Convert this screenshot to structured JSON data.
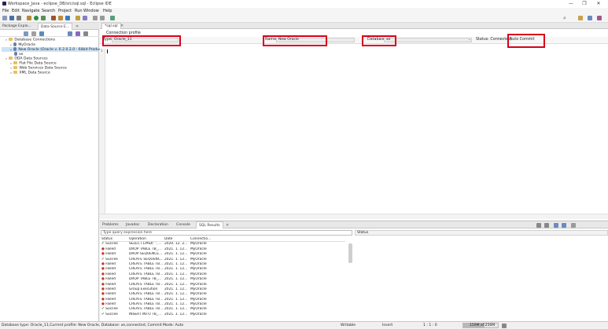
{
  "window": {
    "title": "Workspace_Java - eclipse_DB/src/sql.sql - Eclipse IDE",
    "minimize": "—",
    "maximize": "❐",
    "close": "✕"
  },
  "menu": [
    "File",
    "Edit",
    "Navigate",
    "Search",
    "Project",
    "Run",
    "Window",
    "Help"
  ],
  "left_panel": {
    "tabs": [
      {
        "label": "Package Explo..."
      },
      {
        "label": "Data Source E..."
      }
    ],
    "tree": [
      {
        "label": "Database Connections",
        "indent": 0,
        "icon": "folder-icon"
      },
      {
        "label": "MyOracle",
        "indent": 1,
        "icon": "database-icon"
      },
      {
        "label": "New Oracle (Oracle v. 0.2.0.2.0 - 64bit Product",
        "indent": 1,
        "icon": "database-icon",
        "selected": true
      },
      {
        "label": "xe",
        "indent": 2,
        "icon": "database-icon"
      },
      {
        "label": "ODA Data Sources",
        "indent": 0,
        "icon": "folder-icon"
      },
      {
        "label": "Flat File Data Source",
        "indent": 1,
        "icon": "folder-icon"
      },
      {
        "label": "Web Services Data Source",
        "indent": 1,
        "icon": "folder-icon"
      },
      {
        "label": "XML Data Source",
        "indent": 1,
        "icon": "folder-icon"
      }
    ]
  },
  "editor": {
    "tab_label": "*sql.sql",
    "section_label": "Connection profile",
    "type_label": "Type:",
    "type_value": "Oracle_11",
    "name_label": "Name:",
    "name_value": "New Oracle",
    "database_label": "Database:",
    "database_value": "xe",
    "status_label": "Status: Connected,",
    "autocommit_value": "Auto Commit",
    "line_number": "1"
  },
  "bottom": {
    "tabs": [
      {
        "label": "Problems"
      },
      {
        "label": "Javadoc"
      },
      {
        "label": "Declaration"
      },
      {
        "label": "Console"
      },
      {
        "label": "SQL Results",
        "active": true
      }
    ],
    "filter_placeholder": "Type query expression here",
    "status_pane_label": "Status",
    "columns": [
      "Status",
      "Operation",
      "Date",
      "Connectio..."
    ],
    "rows": [
      {
        "status": "Succee",
        "ok": true,
        "op": "SELECT LPAD(' ', ...",
        "date": "2020. 12. 2...",
        "conn": "MyOracle"
      },
      {
        "status": "Failed",
        "ok": false,
        "op": "DROP TABLE TB_...",
        "date": "2021. 1. 12...",
        "conn": "MyOracle"
      },
      {
        "status": "Failed",
        "ok": false,
        "op": "DROP SEQUENCE...",
        "date": "2021. 1. 12...",
        "conn": "MyOracle"
      },
      {
        "status": "Succee",
        "ok": true,
        "op": "CREATE SEQUENC...",
        "date": "2021. 1. 12...",
        "conn": "MyOracle"
      },
      {
        "status": "Failed",
        "ok": false,
        "op": "CREATE TABLE TB...",
        "date": "2021. 1. 12...",
        "conn": "MyOracle"
      },
      {
        "status": "Failed",
        "ok": false,
        "op": "CREATE TABLE TB...",
        "date": "2021. 1. 12...",
        "conn": "MyOracle"
      },
      {
        "status": "Failed",
        "ok": false,
        "op": "CREATE TABLE TB...",
        "date": "2021. 1. 12...",
        "conn": "MyOracle"
      },
      {
        "status": "Failed",
        "ok": false,
        "op": "DROP TABLE TB_...",
        "date": "2021. 1. 12...",
        "conn": "MyOracle"
      },
      {
        "status": "Failed",
        "ok": false,
        "op": "CREATE TABLE TB...",
        "date": "2021. 1. 12...",
        "conn": "MyOracle"
      },
      {
        "status": "Failed",
        "ok": false,
        "op": "Group Execution",
        "date": "2021. 1. 12...",
        "conn": "MyOracle"
      },
      {
        "status": "Failed",
        "ok": false,
        "op": "CREATE TABLE TB...",
        "date": "2021. 1. 12...",
        "conn": "MyOracle"
      },
      {
        "status": "Failed",
        "ok": false,
        "op": "CREATE TABLE TB...",
        "date": "2021. 1. 12...",
        "conn": "MyOracle"
      },
      {
        "status": "Failed",
        "ok": false,
        "op": "CREATE TABLE TB...",
        "date": "2021. 1. 12...",
        "conn": "MyOracle"
      },
      {
        "status": "Succee",
        "ok": true,
        "op": "CREATE TABLE TB...",
        "date": "2021. 1. 12...",
        "conn": "MyOracle"
      },
      {
        "status": "Succee",
        "ok": true,
        "op": "INSERT INTO TB_...",
        "date": "2021. 1. 12...",
        "conn": "MyOracle"
      }
    ]
  },
  "statusbar": {
    "left": "Database type: Oracle_11,Current profile: New Oracle, Database: xe,connected, Commit Mode: Auto",
    "writable": "Writable",
    "insert": "Insert",
    "position": "1 : 1 : 0",
    "memory": "159M of 256M"
  },
  "colors": {
    "highlight_box": "#d9001b",
    "selection": "#cde3f7",
    "success": "#2a7d2a",
    "failed": "#c0392b"
  }
}
